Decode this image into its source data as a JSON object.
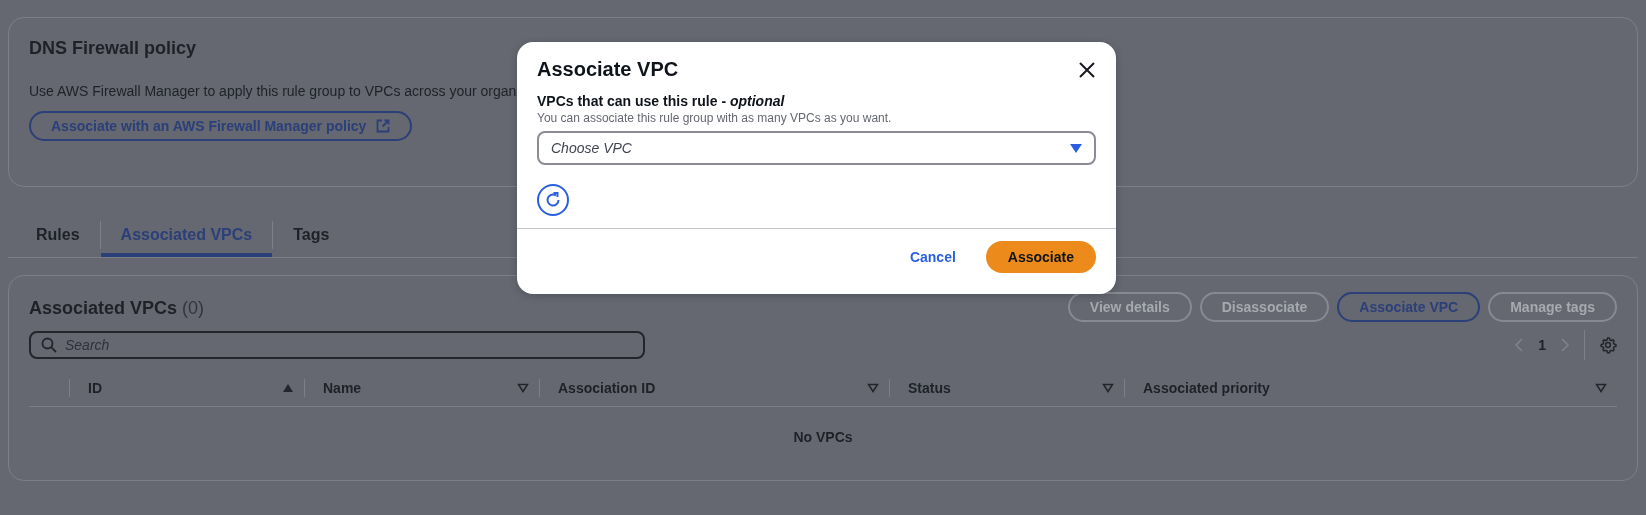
{
  "policy_card": {
    "title": "DNS Firewall policy",
    "description": "Use AWS Firewall Manager to apply this rule group to VPCs across your organ",
    "button": "Associate with an AWS Firewall Manager policy"
  },
  "tabs": [
    {
      "label": "Rules",
      "selected": false
    },
    {
      "label": "Associated VPCs",
      "selected": true
    },
    {
      "label": "Tags",
      "selected": false
    }
  ],
  "vpc_table": {
    "title": "Associated VPCs",
    "count": "(0)",
    "actions": [
      {
        "label": "View details",
        "disabled": true
      },
      {
        "label": "Disassociate",
        "disabled": true
      },
      {
        "label": "Associate VPC",
        "disabled": false
      },
      {
        "label": "Manage tags",
        "disabled": true
      }
    ],
    "search": {
      "placeholder": "Search"
    },
    "pagination": {
      "page": "1",
      "prev_disabled": true,
      "next_disabled": true
    },
    "columns": [
      {
        "label": "ID",
        "sorted": true
      },
      {
        "label": "Name",
        "sorted": false
      },
      {
        "label": "Association ID",
        "sorted": false
      },
      {
        "label": "Status",
        "sorted": false
      },
      {
        "label": "Associated priority",
        "sorted": false
      }
    ],
    "empty_message": "No VPCs"
  },
  "modal": {
    "title": "Associate VPC",
    "field_label": "VPCs that can use this rule - *optional*",
    "field_description": "You can associate this rule group with as many VPCs as you want.",
    "select": {
      "placeholder": "Choose VPC"
    },
    "buttons": [
      {
        "label": "Cancel",
        "kind": "link"
      },
      {
        "label": "Associate",
        "kind": "primary"
      }
    ]
  }
}
